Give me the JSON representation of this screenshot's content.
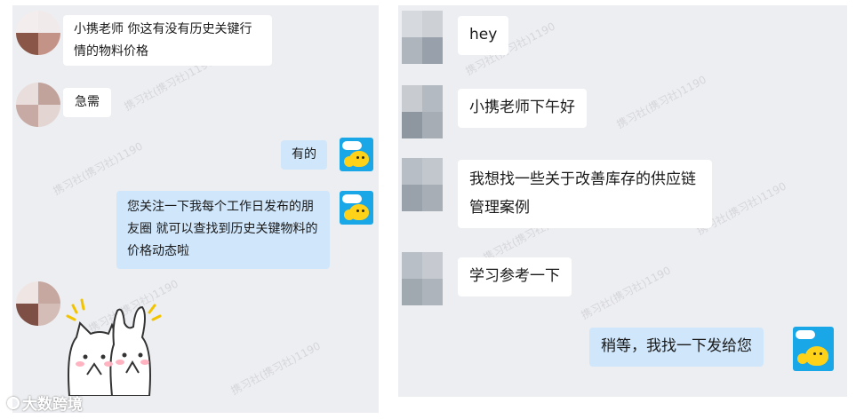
{
  "left_chat": {
    "messages": [
      {
        "side": "incoming",
        "text": "小携老师 你这有没有历史关键行情的物料价格"
      },
      {
        "side": "incoming",
        "text": "急需"
      },
      {
        "side": "outgoing",
        "text": "有的"
      },
      {
        "side": "outgoing",
        "text": "您关注一下我每个工作日发布的朋友圈 就可以查找到历史关键物料的价格动态啦"
      }
    ],
    "sticker": "two-cute-cats-praying-sticker"
  },
  "right_chat": {
    "messages": [
      {
        "side": "incoming",
        "text": "hey"
      },
      {
        "side": "incoming",
        "text": "小携老师下午好"
      },
      {
        "side": "incoming",
        "text": "我想找一些关于改善库存的供应链管理案例"
      },
      {
        "side": "incoming",
        "text": "学习参考一下"
      },
      {
        "side": "outgoing",
        "text": "稍等，我找一下发给您"
      }
    ]
  },
  "watermark": "携习社(携习社)1190",
  "brand": {
    "text": "大数跨境",
    "icon": "brand-ring-icon"
  },
  "colors": {
    "panel_bg": "#edeef1",
    "incoming_bubble": "#ffffff",
    "outgoing_bubble": "#cfe6fb",
    "mascot_bg": "#1aa7e8",
    "mascot_yellow": "#ffd21a"
  }
}
